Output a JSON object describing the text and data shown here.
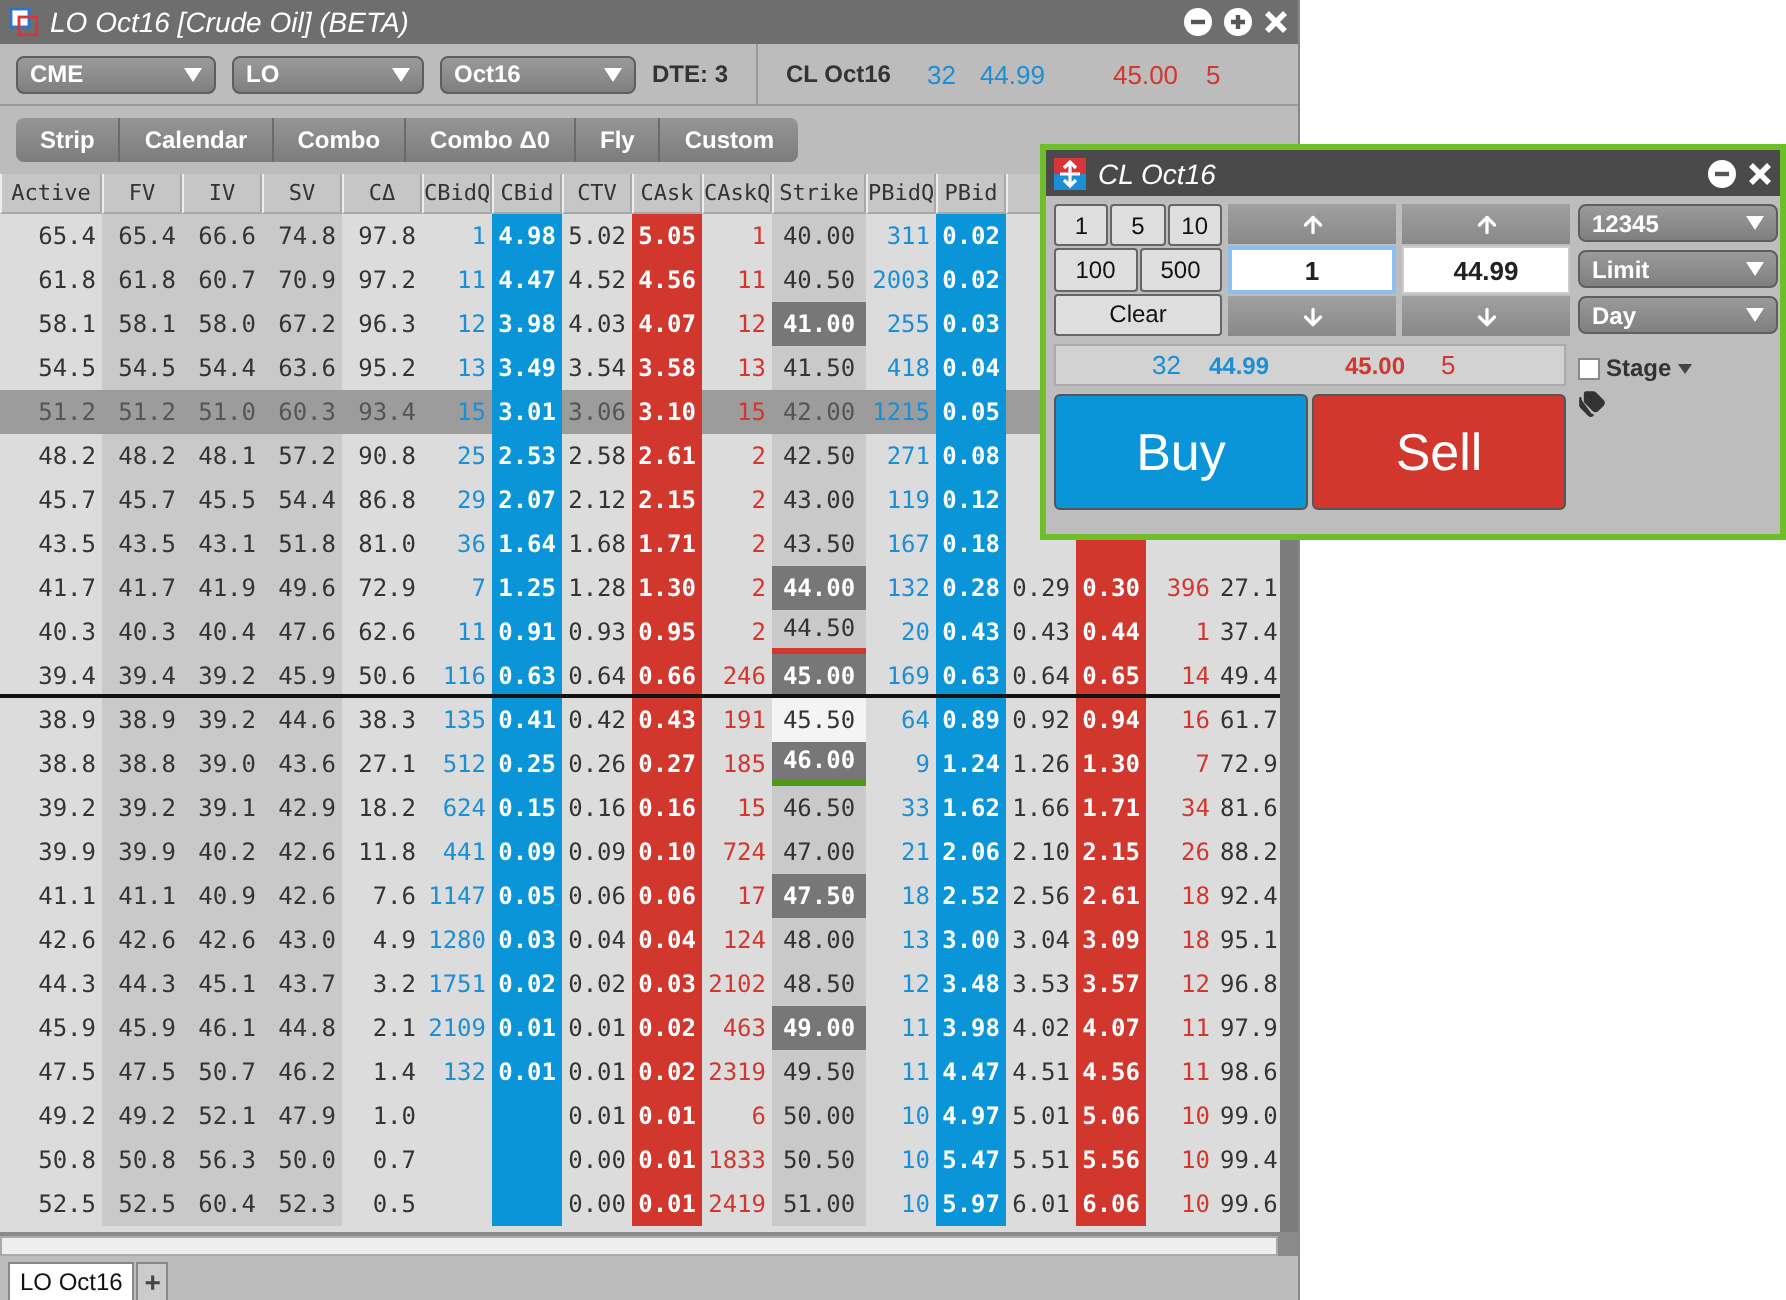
{
  "window": {
    "title": "LO Oct16 [Crude Oil] (BETA)"
  },
  "selectors": [
    {
      "value": "CME"
    },
    {
      "value": "LO"
    },
    {
      "value": "Oct16"
    }
  ],
  "dte": "DTE: 3",
  "quote": {
    "symbol": "CL Oct16",
    "bid_size": "32",
    "bid": "44.99",
    "ask": "45.00",
    "ask_size": "5"
  },
  "strategy_buttons": [
    "Strip",
    "Calendar",
    "Combo",
    "Combo Δ0",
    "Fly",
    "Custom"
  ],
  "table": {
    "columns": [
      "Active",
      "FV",
      "IV",
      "SV",
      "CΔ",
      "CBidQ",
      "CBid",
      "CTV",
      "CAsk",
      "CAskQ",
      "Strike",
      "PBidQ",
      "PBid"
    ],
    "rows": [
      {
        "selected": false,
        "strike_highlighted": false,
        "at_money": false,
        "divider": false,
        "cells": [
          "65.4",
          "65.4",
          "66.6",
          "74.8",
          "97.8",
          "1",
          "4.98",
          "5.02",
          "5.05",
          "1",
          "40.00",
          "311",
          "0.02",
          null,
          null,
          null,
          null
        ]
      },
      {
        "selected": false,
        "strike_highlighted": false,
        "at_money": false,
        "divider": false,
        "cells": [
          "61.8",
          "61.8",
          "60.7",
          "70.9",
          "97.2",
          "11",
          "4.47",
          "4.52",
          "4.56",
          "11",
          "40.50",
          "2003",
          "0.02",
          null,
          null,
          null,
          null
        ]
      },
      {
        "selected": false,
        "strike_highlighted": true,
        "at_money": false,
        "divider": false,
        "cells": [
          "58.1",
          "58.1",
          "58.0",
          "67.2",
          "96.3",
          "12",
          "3.98",
          "4.03",
          "4.07",
          "12",
          "41.00",
          "255",
          "0.03",
          null,
          null,
          null,
          null
        ]
      },
      {
        "selected": false,
        "strike_highlighted": false,
        "at_money": false,
        "divider": false,
        "cells": [
          "54.5",
          "54.5",
          "54.4",
          "63.6",
          "95.2",
          "13",
          "3.49",
          "3.54",
          "3.58",
          "13",
          "41.50",
          "418",
          "0.04",
          null,
          null,
          null,
          null
        ]
      },
      {
        "selected": true,
        "strike_highlighted": false,
        "at_money": false,
        "divider": false,
        "cells": [
          "51.2",
          "51.2",
          "51.0",
          "60.3",
          "93.4",
          "15",
          "3.01",
          "3.06",
          "3.10",
          "15",
          "42.00",
          "1215",
          "0.05",
          null,
          null,
          null,
          null
        ]
      },
      {
        "selected": false,
        "strike_highlighted": false,
        "at_money": false,
        "divider": false,
        "cells": [
          "48.2",
          "48.2",
          "48.1",
          "57.2",
          "90.8",
          "25",
          "2.53",
          "2.58",
          "2.61",
          "2",
          "42.50",
          "271",
          "0.08",
          null,
          null,
          null,
          null
        ]
      },
      {
        "selected": false,
        "strike_highlighted": false,
        "at_money": false,
        "divider": false,
        "cells": [
          "45.7",
          "45.7",
          "45.5",
          "54.4",
          "86.8",
          "29",
          "2.07",
          "2.12",
          "2.15",
          "2",
          "43.00",
          "119",
          "0.12",
          null,
          null,
          null,
          null
        ]
      },
      {
        "selected": false,
        "strike_highlighted": false,
        "at_money": false,
        "divider": false,
        "cells": [
          "43.5",
          "43.5",
          "43.1",
          "51.8",
          "81.0",
          "36",
          "1.64",
          "1.68",
          "1.71",
          "2",
          "43.50",
          "167",
          "0.18",
          null,
          null,
          null,
          null
        ]
      },
      {
        "selected": false,
        "strike_highlighted": true,
        "at_money": false,
        "divider": false,
        "cells": [
          "41.7",
          "41.7",
          "41.9",
          "49.6",
          "72.9",
          "7",
          "1.25",
          "1.28",
          "1.30",
          "2",
          "44.00",
          "132",
          "0.28",
          "0.29",
          "0.30",
          "396",
          "27.1"
        ]
      },
      {
        "selected": false,
        "strike_highlighted": false,
        "at_money": false,
        "underline": {
          "color": "#d2372e"
        },
        "divider": false,
        "cells": [
          "40.3",
          "40.3",
          "40.4",
          "47.6",
          "62.6",
          "11",
          "0.91",
          "0.93",
          "0.95",
          "2",
          "44.50",
          "20",
          "0.43",
          "0.43",
          "0.44",
          "1",
          "37.4"
        ]
      },
      {
        "selected": false,
        "strike_highlighted": true,
        "at_money": false,
        "divider": true,
        "cells": [
          "39.4",
          "39.4",
          "39.2",
          "45.9",
          "50.6",
          "116",
          "0.63",
          "0.64",
          "0.66",
          "246",
          "45.00",
          "169",
          "0.63",
          "0.64",
          "0.65",
          "14",
          "49.4"
        ]
      },
      {
        "selected": false,
        "strike_highlighted": false,
        "at_money": true,
        "divider": false,
        "cells": [
          "38.9",
          "38.9",
          "39.2",
          "44.6",
          "38.3",
          "135",
          "0.41",
          "0.42",
          "0.43",
          "191",
          "45.50",
          "64",
          "0.89",
          "0.92",
          "0.94",
          "16",
          "61.7"
        ]
      },
      {
        "selected": false,
        "strike_highlighted": true,
        "at_money": false,
        "underline": {
          "color": "#4f9a12"
        },
        "divider": false,
        "cells": [
          "38.8",
          "38.8",
          "39.0",
          "43.6",
          "27.1",
          "512",
          "0.25",
          "0.26",
          "0.27",
          "185",
          "46.00",
          "9",
          "1.24",
          "1.26",
          "1.30",
          "7",
          "72.9"
        ]
      },
      {
        "selected": false,
        "strike_highlighted": false,
        "at_money": false,
        "divider": false,
        "cells": [
          "39.2",
          "39.2",
          "39.1",
          "42.9",
          "18.2",
          "624",
          "0.15",
          "0.16",
          "0.16",
          "15",
          "46.50",
          "33",
          "1.62",
          "1.66",
          "1.71",
          "34",
          "81.6"
        ]
      },
      {
        "selected": false,
        "strike_highlighted": false,
        "at_money": false,
        "divider": false,
        "cells": [
          "39.9",
          "39.9",
          "40.2",
          "42.6",
          "11.8",
          "441",
          "0.09",
          "0.09",
          "0.10",
          "724",
          "47.00",
          "21",
          "2.06",
          "2.10",
          "2.15",
          "26",
          "88.2"
        ]
      },
      {
        "selected": false,
        "strike_highlighted": true,
        "at_money": false,
        "divider": false,
        "cells": [
          "41.1",
          "41.1",
          "40.9",
          "42.6",
          "7.6",
          "1147",
          "0.05",
          "0.06",
          "0.06",
          "17",
          "47.50",
          "18",
          "2.52",
          "2.56",
          "2.61",
          "18",
          "92.4"
        ]
      },
      {
        "selected": false,
        "strike_highlighted": false,
        "at_money": false,
        "divider": false,
        "cells": [
          "42.6",
          "42.6",
          "42.6",
          "43.0",
          "4.9",
          "1280",
          "0.03",
          "0.04",
          "0.04",
          "124",
          "48.00",
          "13",
          "3.00",
          "3.04",
          "3.09",
          "18",
          "95.1"
        ]
      },
      {
        "selected": false,
        "strike_highlighted": false,
        "at_money": false,
        "divider": false,
        "cells": [
          "44.3",
          "44.3",
          "45.1",
          "43.7",
          "3.2",
          "1751",
          "0.02",
          "0.02",
          "0.03",
          "2102",
          "48.50",
          "12",
          "3.48",
          "3.53",
          "3.57",
          "12",
          "96.8"
        ]
      },
      {
        "selected": false,
        "strike_highlighted": true,
        "at_money": false,
        "divider": false,
        "cells": [
          "45.9",
          "45.9",
          "46.1",
          "44.8",
          "2.1",
          "2109",
          "0.01",
          "0.01",
          "0.02",
          "463",
          "49.00",
          "11",
          "3.98",
          "4.02",
          "4.07",
          "11",
          "97.9"
        ]
      },
      {
        "selected": false,
        "strike_highlighted": false,
        "at_money": false,
        "divider": false,
        "cells": [
          "47.5",
          "47.5",
          "50.7",
          "46.2",
          "1.4",
          "132",
          "0.01",
          "0.01",
          "0.02",
          "2319",
          "49.50",
          "11",
          "4.47",
          "4.51",
          "4.56",
          "11",
          "98.6"
        ]
      },
      {
        "selected": false,
        "strike_highlighted": false,
        "at_money": false,
        "divider": false,
        "cells": [
          "49.2",
          "49.2",
          "52.1",
          "47.9",
          "1.0",
          null,
          null,
          "0.01",
          "0.01",
          "6",
          "50.00",
          "10",
          "4.97",
          "5.01",
          "5.06",
          "10",
          "99.0"
        ]
      },
      {
        "selected": false,
        "strike_highlighted": false,
        "at_money": false,
        "divider": false,
        "cells": [
          "50.8",
          "50.8",
          "56.3",
          "50.0",
          "0.7",
          null,
          null,
          "0.00",
          "0.01",
          "1833",
          "50.50",
          "10",
          "5.47",
          "5.51",
          "5.56",
          "10",
          "99.4"
        ]
      },
      {
        "selected": false,
        "strike_highlighted": false,
        "at_money": false,
        "divider": false,
        "cells": [
          "52.5",
          "52.5",
          "60.4",
          "52.3",
          "0.5",
          null,
          null,
          "0.00",
          "0.01",
          "2419",
          "51.00",
          "10",
          "5.97",
          "6.01",
          "6.06",
          "10",
          "99.6"
        ]
      }
    ]
  },
  "order_ticket": {
    "title": "CL Oct16",
    "quantity_presets": [
      "1",
      "5",
      "10",
      "100",
      "500"
    ],
    "clear": "Clear",
    "quantity": "1",
    "price": "44.99",
    "account": "12345",
    "order_type": "Limit",
    "duration": "Day",
    "quote": {
      "bid_size": "32",
      "bid": "44.99",
      "ask": "45.00",
      "ask_size": "5"
    },
    "stage": {
      "label": "Stage",
      "checked": false
    },
    "buy": "Buy",
    "sell": "Sell"
  },
  "tabs": [
    {
      "label": "LO Oct16",
      "selected": true
    }
  ],
  "add_tab": "+"
}
